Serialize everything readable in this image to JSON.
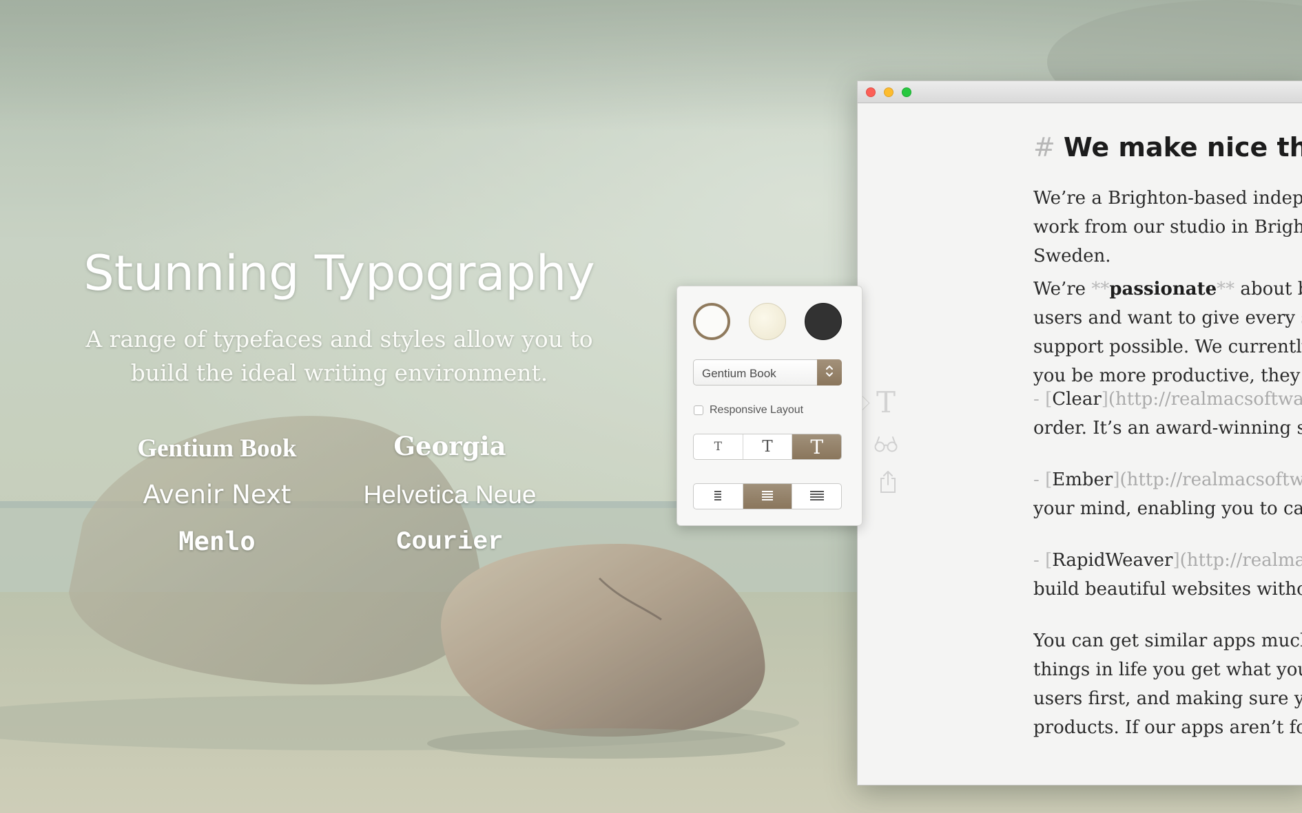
{
  "marketing": {
    "title": "Stunning Typography",
    "subtitle_line1": "A range of typefaces and styles allow you to",
    "subtitle_line2": "build the ideal writing environment.",
    "fonts": [
      "Gentium Book",
      "Georgia",
      "Avenir Next",
      "Helvetica Neue",
      "Menlo",
      "Courier"
    ]
  },
  "popover": {
    "themes": [
      {
        "name": "white",
        "color": "#fbfbf9",
        "selected": true
      },
      {
        "name": "cream",
        "color": "#f3eedb",
        "selected": false
      },
      {
        "name": "dark",
        "color": "#323232",
        "selected": false
      }
    ],
    "font_select_value": "Gentium Book",
    "responsive_layout_label": "Responsive Layout",
    "responsive_layout_checked": false,
    "text_size_glyph": "T",
    "text_size_options": [
      "small",
      "medium",
      "large"
    ],
    "text_size_selected": "large",
    "line_width_options": [
      "narrow",
      "medium",
      "wide"
    ],
    "line_width_selected": "medium",
    "accent_color": "#8f7a5d"
  },
  "sidebar": {
    "typography_glyph": "T",
    "icons": [
      "typography-icon",
      "reading-glasses-icon",
      "share-icon"
    ]
  },
  "document": {
    "heading_marker": "#",
    "heading": "We make nice things",
    "intro": [
      "We’re a Brighton-based indepen",
      "work from our studio in Brighto",
      "Sweden."
    ],
    "p2_line1_before": "We’re ",
    "p2_mark": "**",
    "p2_bold": "passionate",
    "p2_line1_after": " about bui",
    "p2_rest": [
      "users and want to give every sin",
      "support possible. We currently l",
      "you be more productive, they ar"
    ],
    "list_dash": "-",
    "list": [
      {
        "open": "[",
        "name": "Clear",
        "close": "]",
        "url": "(http://realmacsoftwar",
        "cont": "order. It’s an award-winning sup"
      },
      {
        "open": "[",
        "name": "Ember",
        "close": "]",
        "url": "(http://realmacsoftwa",
        "cont": "your mind, enabling you to capt"
      },
      {
        "open": "[",
        "name": "RapidWeaver",
        "close": "]",
        "url": "(http://realmac",
        "cont": "build beautiful websites without"
      }
    ],
    "last": [
      "You can get similar apps much c",
      "things in life you get what you p",
      "users first, and making sure you",
      "products. If our apps aren’t for y"
    ]
  }
}
